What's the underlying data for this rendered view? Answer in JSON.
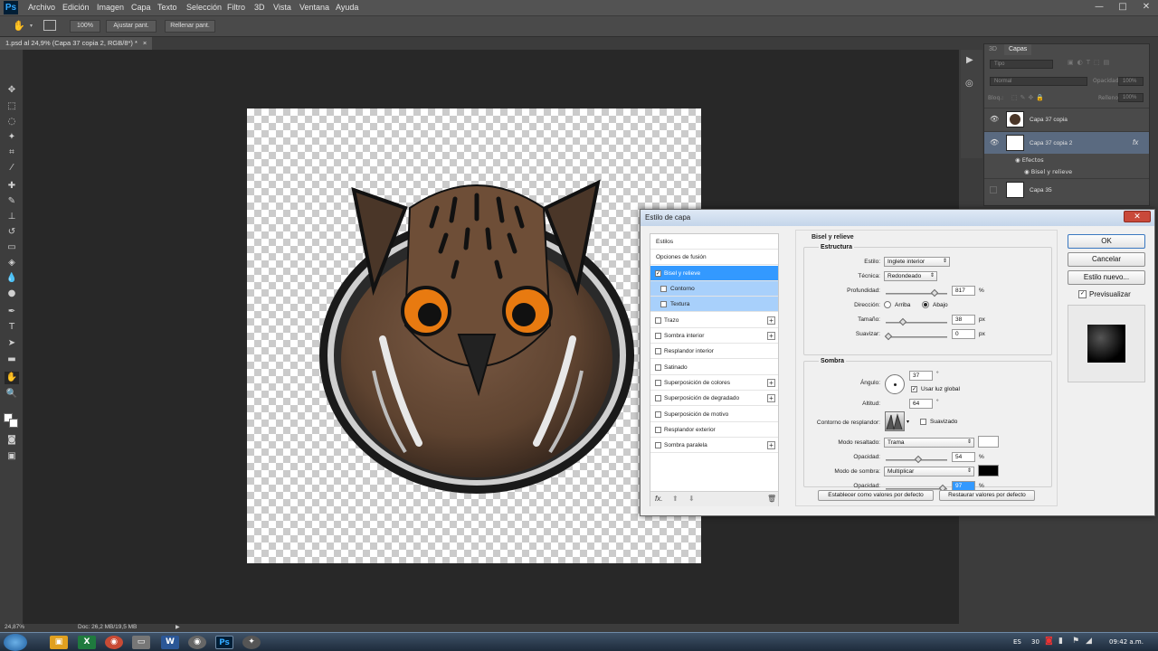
{
  "app": {
    "logo": "Ps",
    "menu": [
      "Archivo",
      "Edición",
      "Imagen",
      "Capa",
      "Texto",
      "Selección",
      "Filtro",
      "3D",
      "Vista",
      "Ventana",
      "Ayuda"
    ],
    "window_controls": [
      "—",
      "□",
      "✕"
    ]
  },
  "options_bar": {
    "zoom_value": "100%",
    "fit_screen": "Ajustar pant.",
    "fill_screen": "Rellenar pant."
  },
  "document_tab": "1.psd al 24,9% (Capa 37 copia 2, RGB/8*) *",
  "status": {
    "zoom": "24,87%",
    "doc": "Doc: 26,2 MB/19,5 MB"
  },
  "layers_panel": {
    "tabs": [
      "3D",
      "Capas"
    ],
    "filter_label": "Tipo",
    "blend_mode": "Normal",
    "opacity_label": "Opacidad:",
    "opacity_value": "100%",
    "lock_label": "Bloq.:",
    "fill_label": "Relleno:",
    "fill_value": "100%",
    "layers": [
      {
        "name": "Capa 37 copia",
        "selected": false
      },
      {
        "name": "Capa 37 copia 2",
        "selected": true,
        "fx": "fx"
      },
      {
        "name": "Capa 35",
        "selected": false
      }
    ],
    "effects_label": "Efectos",
    "effect_item": "Bisel y relieve"
  },
  "dialog": {
    "title": "Estilo de capa",
    "styles_header": "Estilos",
    "blend_options": "Opciones de fusión",
    "styles": [
      {
        "label": "Bisel y relieve",
        "checked": true,
        "selected": true
      },
      {
        "label": "Contorno",
        "checked": false,
        "sub": true
      },
      {
        "label": "Textura",
        "checked": false,
        "sub": true
      },
      {
        "label": "Trazo",
        "checked": false,
        "plus": true
      },
      {
        "label": "Sombra interior",
        "checked": false,
        "plus": true
      },
      {
        "label": "Resplandor interior",
        "checked": false
      },
      {
        "label": "Satinado",
        "checked": false
      },
      {
        "label": "Superposición de colores",
        "checked": false,
        "plus": true
      },
      {
        "label": "Superposición de degradado",
        "checked": false,
        "plus": true
      },
      {
        "label": "Superposición de motivo",
        "checked": false
      },
      {
        "label": "Resplandor exterior",
        "checked": false
      },
      {
        "label": "Sombra paralela",
        "checked": false,
        "plus": true
      }
    ],
    "section_title": "Bisel y relieve",
    "structure": {
      "title": "Estructura",
      "style_label": "Estilo:",
      "style_value": "Inglete interior",
      "technique_label": "Técnica:",
      "technique_value": "Redondeado",
      "depth_label": "Profundidad:",
      "depth_value": "817",
      "depth_unit": "%",
      "depth_level": 0.82,
      "direction_label": "Dirección:",
      "dir_up": "Arriba",
      "dir_down": "Abajo",
      "size_label": "Tamaño:",
      "size_value": "38",
      "size_unit": "px",
      "size_level": 0.25,
      "soften_label": "Suavizar:",
      "soften_value": "0",
      "soften_unit": "px",
      "soften_level": 0.0
    },
    "shading": {
      "title": "Sombra",
      "angle_label": "Ángulo:",
      "angle_value": "37",
      "angle_unit": "°",
      "global_light": "Usar luz global",
      "altitude_label": "Altitud:",
      "altitude_value": "64",
      "altitude_unit": "°",
      "gloss_label": "Contorno de resplandor:",
      "antialias": "Suavizado",
      "highlight_label": "Modo resaltado:",
      "highlight_value": "Trama",
      "highlight_color": "#ffffff",
      "h_opacity_label": "Opacidad:",
      "h_opacity_value": "54",
      "h_opacity_unit": "%",
      "h_opacity_level": 0.54,
      "shadow_label": "Modo de sombra:",
      "shadow_value": "Multiplicar",
      "shadow_color": "#000000",
      "s_opacity_label": "Opacidad:",
      "s_opacity_value": "97",
      "s_opacity_unit": "%",
      "s_opacity_level": 0.97
    },
    "make_default": "Establecer como valores por defecto",
    "reset_default": "Restaurar valores por defecto",
    "ok": "OK",
    "cancel": "Cancelar",
    "new_style": "Estilo nuevo...",
    "preview": "Previsualizar"
  },
  "taskbar": {
    "lang": "ES",
    "temp": "30",
    "time": "09:42 a.m."
  },
  "colors": {
    "accent": "#3399ff",
    "owl_brown": "#5e4330",
    "owl_eye": "#e87a10"
  }
}
